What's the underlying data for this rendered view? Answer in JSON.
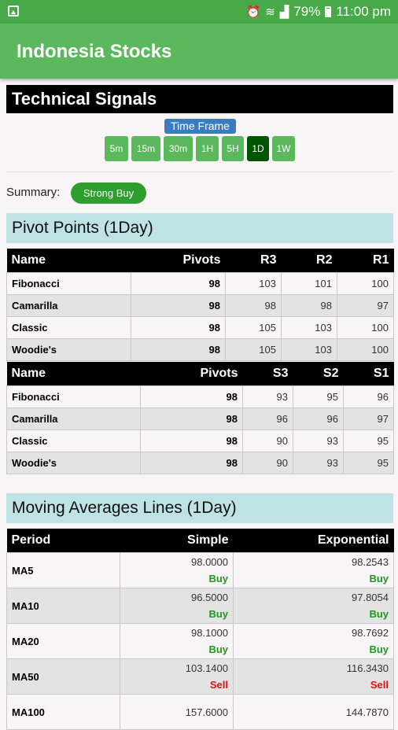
{
  "status_bar": {
    "battery": "79%",
    "time": "11:00 pm"
  },
  "app": {
    "title": "Indonesia Stocks"
  },
  "technical": {
    "title": "Technical Signals",
    "time_frame_label": "Time Frame",
    "time_frames": [
      "5m",
      "15m",
      "30m",
      "1H",
      "5H",
      "1D",
      "1W"
    ],
    "active_time_frame": "1D",
    "summary_label": "Summary:",
    "summary_value": "Strong Buy"
  },
  "pivot": {
    "title": "Pivot Points (1Day)",
    "resistance_headers": [
      "Name",
      "Pivots",
      "R3",
      "R2",
      "R1"
    ],
    "resistance_rows": [
      [
        "Fibonacci",
        "98",
        "103",
        "101",
        "100"
      ],
      [
        "Camarilla",
        "98",
        "98",
        "98",
        "97"
      ],
      [
        "Classic",
        "98",
        "105",
        "103",
        "100"
      ],
      [
        "Woodie's",
        "98",
        "105",
        "103",
        "100"
      ]
    ],
    "support_headers": [
      "Name",
      "Pivots",
      "S3",
      "S2",
      "S1"
    ],
    "support_rows": [
      [
        "Fibonacci",
        "98",
        "93",
        "95",
        "96"
      ],
      [
        "Camarilla",
        "98",
        "96",
        "96",
        "97"
      ],
      [
        "Classic",
        "98",
        "90",
        "93",
        "95"
      ],
      [
        "Woodie's",
        "98",
        "90",
        "93",
        "95"
      ]
    ]
  },
  "moving_averages": {
    "title": "Moving Averages Lines (1Day)",
    "headers": [
      "Period",
      "Simple",
      "Exponential"
    ],
    "rows": [
      {
        "period": "MA5",
        "simple": "98.0000",
        "simple_signal": "Buy",
        "exp": "98.2543",
        "exp_signal": "Buy"
      },
      {
        "period": "MA10",
        "simple": "96.5000",
        "simple_signal": "Buy",
        "exp": "97.8054",
        "exp_signal": "Buy"
      },
      {
        "period": "MA20",
        "simple": "98.1000",
        "simple_signal": "Buy",
        "exp": "98.7692",
        "exp_signal": "Buy"
      },
      {
        "period": "MA50",
        "simple": "103.1400",
        "simple_signal": "Sell",
        "exp": "116.3430",
        "exp_signal": "Sell"
      },
      {
        "period": "MA100",
        "simple": "157.6000",
        "simple_signal": "",
        "exp": "144.7870",
        "exp_signal": ""
      }
    ]
  }
}
